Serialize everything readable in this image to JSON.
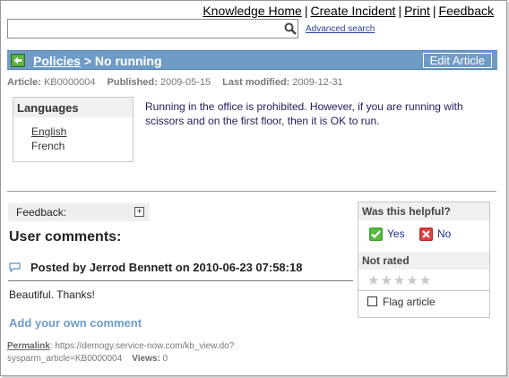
{
  "top_links": {
    "knowledge_home": "Knowledge Home",
    "create_incident": "Create Incident",
    "print": "Print",
    "feedback": "Feedback",
    "separator": "|"
  },
  "search": {
    "value": "",
    "placeholder": "",
    "advanced_label": "Advanced search",
    "icon": "search-icon"
  },
  "title_bar": {
    "breadcrumb_link": "Policies",
    "separator": ">",
    "title": "No running",
    "edit_button": "Edit Article",
    "back_icon": "back-arrow-icon",
    "color": "#6f9cc6"
  },
  "meta": {
    "article_label": "Article:",
    "article_value": "KB0000004",
    "published_label": "Published:",
    "published_value": "2009-05-15",
    "modified_label": "Last modified:",
    "modified_value": "2009-12-31"
  },
  "languages": {
    "heading": "Languages",
    "items": [
      "English",
      "French"
    ]
  },
  "article": {
    "body": "Running in the office is prohibited. However, if you are running with scissors and on the first floor, then it is OK to run."
  },
  "feedback": {
    "label": "Feedback:",
    "expand_icon": "plus-icon"
  },
  "comments": {
    "heading": "User comments:",
    "items": [
      {
        "posted": "Posted by Jerrod Bennett on 2010-06-23 07:58:18",
        "text": "Beautiful. Thanks!"
      }
    ],
    "add_label": "Add your own comment"
  },
  "permalink": {
    "label": "Permalink",
    "url_line1": ": https://demogy.service-now.com/kb_view.do?",
    "url_line2": "sysparm_article=KB0000004",
    "views_label": "Views:",
    "views_value": "0"
  },
  "sidebar": {
    "helpful_heading": "Was this helpful?",
    "yes_label": "Yes",
    "no_label": "No",
    "rating_heading": "Not rated",
    "stars": 5,
    "rating_value": 0,
    "flag_label": "Flag article"
  }
}
